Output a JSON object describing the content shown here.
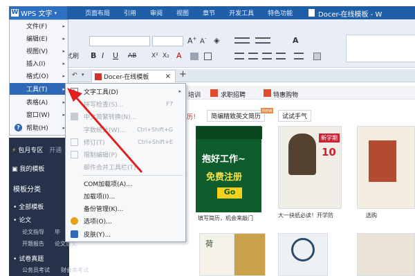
{
  "title_bar": {
    "app_button": "WPS 文字",
    "tabs": [
      "页面布局",
      "引用",
      "审阅",
      "视图",
      "章节",
      "开发工具",
      "特色功能"
    ],
    "doc_title": "Docer-在线模板 - W"
  },
  "ribbon": {
    "format_label": "式刷",
    "font_size_placeholder": "",
    "bold": "B",
    "italic": "I",
    "underline": "U",
    "abc": "AB",
    "sup": "X²",
    "sub": "X₂",
    "font_color": "A"
  },
  "doc_tab": {
    "label": "Docer-在线模板",
    "close": "×",
    "new_tab": "+"
  },
  "main_menu": {
    "items": [
      {
        "label": "文件(F)",
        "arrow": "▸"
      },
      {
        "label": "编辑(E)",
        "arrow": "▸"
      },
      {
        "label": "视图(V)",
        "arrow": "▸"
      },
      {
        "label": "插入(I)",
        "arrow": "▸"
      },
      {
        "label": "格式(O)",
        "arrow": "▸"
      },
      {
        "label": "工具(T)",
        "arrow": "▸"
      },
      {
        "label": "表格(A)",
        "arrow": "▸"
      },
      {
        "label": "窗口(W)",
        "arrow": "▸"
      },
      {
        "label": "帮助(H)",
        "arrow": "▸"
      }
    ]
  },
  "tools_submenu": {
    "items": [
      {
        "label": "文字工具(D)",
        "shortcut": "",
        "disabled": false,
        "arrow": "▸"
      },
      {
        "label": "拼写检查(S)...",
        "shortcut": "F7",
        "disabled": true,
        "arrow": ""
      },
      {
        "label": "中文简繁转换(N)...",
        "shortcut": "",
        "disabled": true,
        "arrow": ""
      },
      {
        "label": "字数统计(W)...",
        "shortcut": "Ctrl+Shift+G",
        "disabled": true,
        "arrow": ""
      },
      {
        "label": "修订(T)",
        "shortcut": "Ctrl+Shift+E",
        "disabled": true,
        "arrow": ""
      },
      {
        "label": "限制编辑(P)",
        "shortcut": "",
        "disabled": true,
        "arrow": ""
      },
      {
        "label": "邮件合并工具栏(T)",
        "shortcut": "",
        "disabled": true,
        "arrow": ""
      },
      {
        "label": "COM加载项(A)...",
        "shortcut": "",
        "disabled": false,
        "arrow": ""
      },
      {
        "label": "加载项(I)...",
        "shortcut": "",
        "disabled": false,
        "arrow": ""
      },
      {
        "label": "备份管理(K)...",
        "shortcut": "",
        "disabled": false,
        "arrow": ""
      },
      {
        "label": "选项(O)...",
        "shortcut": "",
        "disabled": false,
        "arrow": ""
      },
      {
        "label": "皮肤(Y)...",
        "shortcut": "",
        "disabled": false,
        "arrow": ""
      }
    ]
  },
  "sidebar": {
    "baoyue": "包月专区",
    "kaitong": "开通",
    "my_templates": "我的模板",
    "category_title": "模板分类",
    "all_templates": "全部模板",
    "paper": "论文",
    "paper_sub1": "论文指导",
    "paper_sub2": "毕",
    "paper_sub3": "开题报告",
    "paper_sub4": "论文范文",
    "exam": "试卷真题",
    "exam_sub1": "公务员考试",
    "exam_sub2": "财会类考试"
  },
  "content": {
    "top_links": [
      "培训",
      "求职招聘",
      "特惠购物"
    ],
    "notice": "历！",
    "pill1": "简编精致英文简历",
    "pill1_badge": "new",
    "pill2": "试试手气",
    "card1_text1": "抱好工作~",
    "card1_text2": "免费注册",
    "card1_text3": "Go",
    "card1_caption": "填写简历，机会来敲门",
    "card2_caption": "大一抉纸必读！开学防",
    "card3_caption": "选购",
    "card_badge": "新学期",
    "card_badge2": "10",
    "lower_card1": "荷",
    "lower_card2": ""
  },
  "colors": {
    "title_bar": "#1f5ea8",
    "highlight": "#2f68b7",
    "sidebar": "#26324a",
    "arrow_red": "#e02020"
  }
}
